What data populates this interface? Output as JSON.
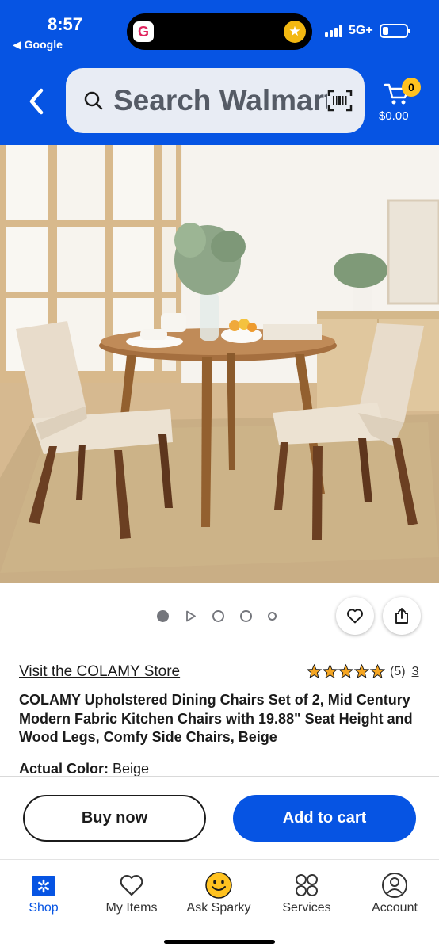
{
  "status_bar": {
    "time": "8:57",
    "back_app": "◀ Google",
    "network": "5G+"
  },
  "header": {
    "search_placeholder": "Search Walmart",
    "cart_count": "0",
    "cart_total": "$0.00",
    "brand_color": "#0654e3",
    "accent_color": "#ffc220"
  },
  "gallery": {
    "image_alt": "Dining set photo",
    "dots": [
      "image",
      "video",
      "image",
      "image",
      "image"
    ],
    "active_index": 0
  },
  "product": {
    "store_link": "Visit the COLAMY Store",
    "rating": 5,
    "rating_count": "(5)",
    "review_count": "3",
    "title": "COLAMY Upholstered Dining Chairs Set of 2, Mid Century Modern Fabric Kitchen Chairs with 19.88\" Seat Height and Wood Legs, Comfy Side Chairs, Beige",
    "color_label": "Actual Color:",
    "color_value": "Beige"
  },
  "actions": {
    "buy_now": "Buy now",
    "add_to_cart": "Add to cart"
  },
  "bottom_nav": {
    "items": [
      {
        "label": "Shop",
        "icon": "spark-icon"
      },
      {
        "label": "My Items",
        "icon": "heart-icon"
      },
      {
        "label": "Ask Sparky",
        "icon": "smiley-icon"
      },
      {
        "label": "Services",
        "icon": "grid-circles-icon"
      },
      {
        "label": "Account",
        "icon": "user-icon"
      }
    ],
    "active": "Shop"
  }
}
